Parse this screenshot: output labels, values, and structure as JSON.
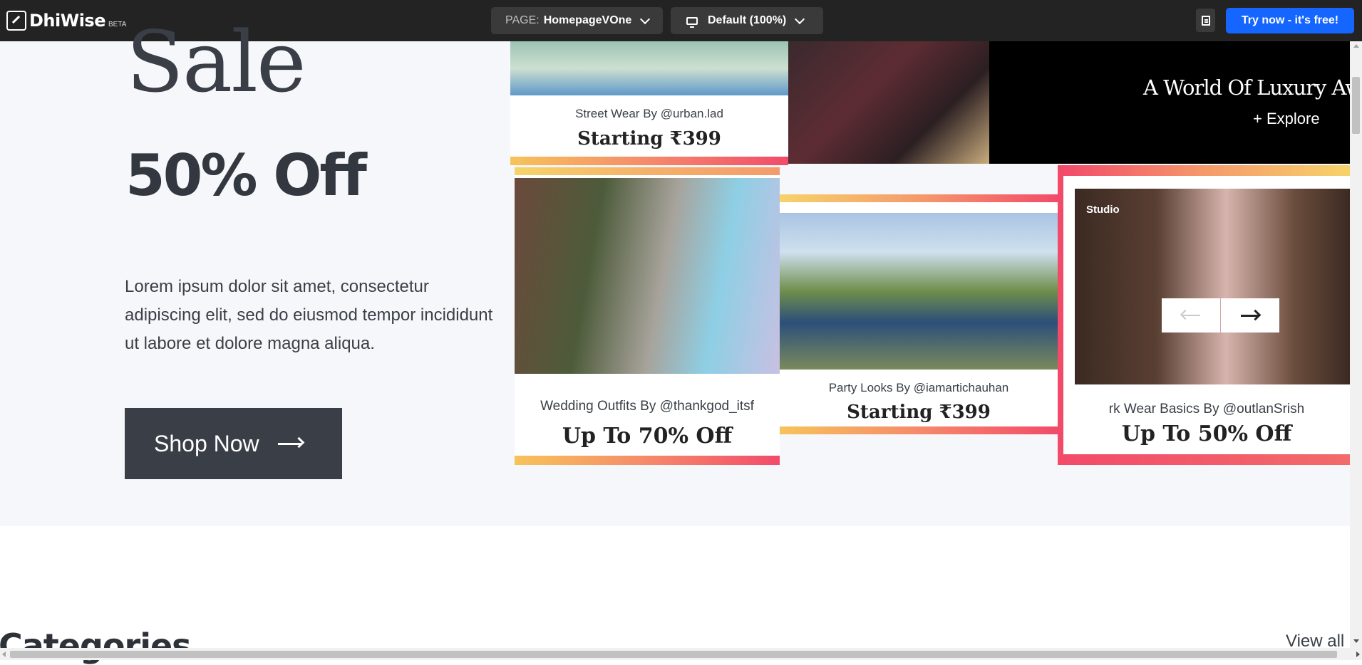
{
  "topbar": {
    "logo_text": "DhiWise",
    "logo_badge": "BETA",
    "page_label": "PAGE:",
    "page_name": "HomepageVOne",
    "device_label": "Default (100%)",
    "cta_label": "Try now - it's free!"
  },
  "hero": {
    "sale": "Sale",
    "discount": "50% Off",
    "description": "Lorem ipsum dolor sit amet, consectetur adipiscing elit, sed do eiusmod tempor incididunt ut labore et dolore magna aliqua.",
    "shop_label": "Shop Now"
  },
  "banners": [
    {
      "caption": "Street Wear By @urban.lad",
      "price": "Starting ₹399"
    },
    {
      "caption": "",
      "price": ""
    },
    {
      "caption": "A World Of Luxury Aw",
      "price": "+ Explore"
    },
    {
      "caption": "Wedding Outfits By @thankgod_itsf",
      "price": "Up To 70% Off"
    },
    {
      "caption": "Party Looks By @iamartichauhan",
      "price": "Starting ₹399"
    },
    {
      "caption": "rk Wear Basics By @outlanSrish",
      "price": "Up To 50% Off",
      "badge": "Studio"
    }
  ],
  "categories": {
    "title": "Categories",
    "view_all": "View all"
  },
  "colors": {
    "topbar_bg": "#232323",
    "cta_blue": "#1565ff",
    "hero_bg": "#f6f7fa",
    "shop_bg": "#3a3f47",
    "accent_pink": "#f24b6a"
  }
}
